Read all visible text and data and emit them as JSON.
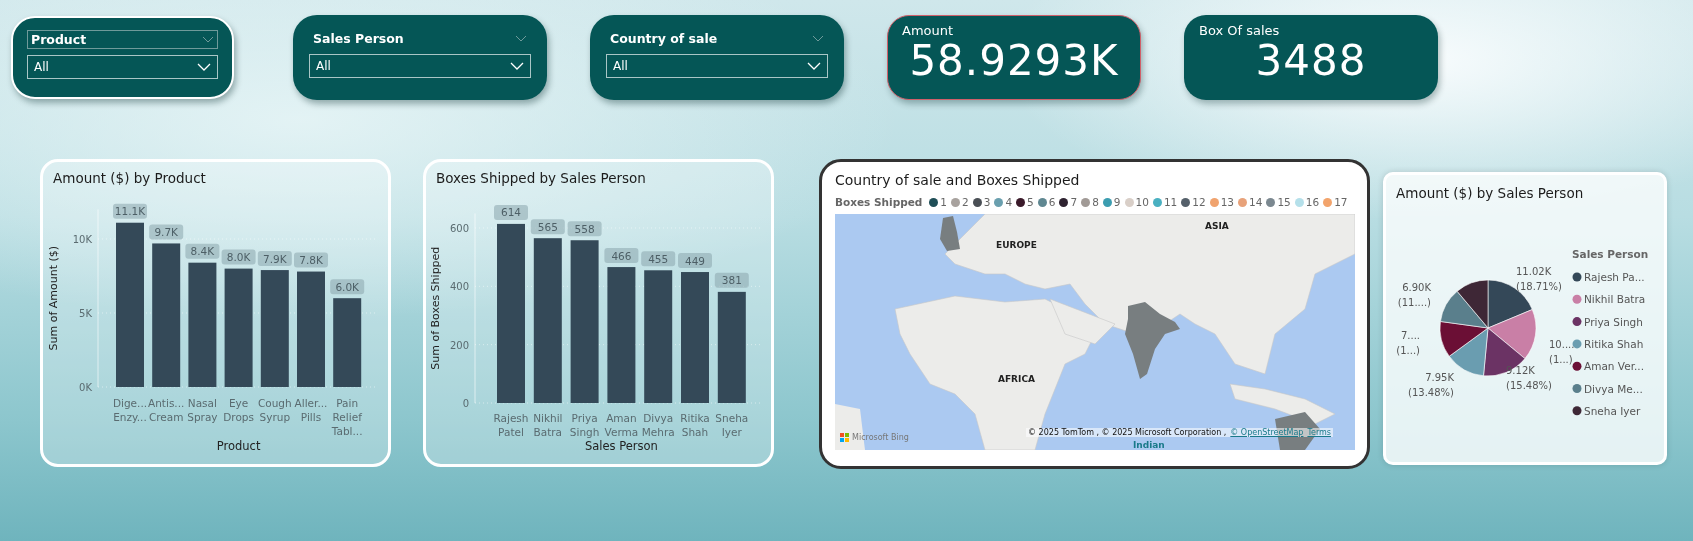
{
  "slicers": [
    {
      "title": "Product",
      "value": "All",
      "selected": true
    },
    {
      "title": "Sales Person",
      "value": "All",
      "selected": false
    },
    {
      "title": "Country of sale",
      "value": "All",
      "selected": false
    }
  ],
  "kpis": [
    {
      "label": "Amount",
      "value": "58.9293K"
    },
    {
      "label": "Box Of sales",
      "value": "3488"
    }
  ],
  "bar_charts": [
    {
      "chart_data": {
        "type": "bar",
        "title": "Amount ($) by Product",
        "xlabel": "Product",
        "ylabel": "Sum of Amount ($)",
        "categories": [
          "Dige... Enzy...",
          "Antis... Cream",
          "Nasal Spray",
          "Eye Drops",
          "Cough Syrup",
          "Aller... Pills",
          "Pain Relief Tabl..."
        ],
        "values": [
          11100,
          9700,
          8400,
          8000,
          7900,
          7800,
          6000
        ],
        "value_labels": [
          "11.1K",
          "9.7K",
          "8.4K",
          "8.0K",
          "7.9K",
          "7.8K",
          "6.0K"
        ],
        "grid": true,
        "ylim": [
          0,
          12000
        ],
        "yticks": [
          {
            "value": 0,
            "label": "0K"
          },
          {
            "value": 5000,
            "label": "5K"
          },
          {
            "value": 10000,
            "label": "10K"
          }
        ]
      }
    },
    {
      "chart_data": {
        "type": "bar",
        "title": "Boxes Shipped by Sales Person",
        "xlabel": "Sales Person",
        "ylabel": "Sum of Boxes Shipped",
        "categories": [
          "Rajesh Patel",
          "Nikhil Batra",
          "Priya Singh",
          "Aman Verma",
          "Divya Mehra",
          "Ritika Shah",
          "Sneha Iyer"
        ],
        "values": [
          614,
          565,
          558,
          466,
          455,
          449,
          381
        ],
        "value_labels": [
          "614",
          "565",
          "558",
          "466",
          "455",
          "449",
          "381"
        ],
        "grid": true,
        "ylim": [
          0,
          650
        ],
        "yticks": [
          0,
          200,
          400,
          600
        ]
      }
    }
  ],
  "map": {
    "title": "Country of sale and Boxes Shipped",
    "legend": {
      "title": "Boxes Shipped",
      "items": [
        {
          "label": "1",
          "color": "#1f4e57"
        },
        {
          "label": "2",
          "color": "#a8a29e"
        },
        {
          "label": "3",
          "color": "#4a4f55"
        },
        {
          "label": "4",
          "color": "#6a9fae"
        },
        {
          "label": "5",
          "color": "#3b1a2a"
        },
        {
          "label": "6",
          "color": "#5f8791"
        },
        {
          "label": "7",
          "color": "#2e2230"
        },
        {
          "label": "8",
          "color": "#a19a96"
        },
        {
          "label": "9",
          "color": "#3c9db0"
        },
        {
          "label": "10",
          "color": "#d9cfc8"
        },
        {
          "label": "11",
          "color": "#4ab0c1"
        },
        {
          "label": "12",
          "color": "#55606a"
        },
        {
          "label": "13",
          "color": "#f0a36e"
        },
        {
          "label": "14",
          "color": "#e8a27a"
        },
        {
          "label": "15",
          "color": "#7b8890"
        },
        {
          "label": "16",
          "color": "#b5e0ea"
        },
        {
          "label": "17",
          "color": "#f2a46c"
        }
      ]
    },
    "region_labels": [
      "EUROPE",
      "ASIA",
      "AFRICA",
      "Indian"
    ],
    "logo": "Microsoft Bing",
    "attribution": "© 2025 TomTom , © 2025 Microsoft Corporation ,",
    "attribution_links": [
      "© OpenStreetMap",
      "Terms"
    ]
  },
  "pie_chart": {
    "legend_title": "Sales Person",
    "slice_labels": [
      "11.02K (18.71%)",
      "6.90K (11....)",
      "7.... (1...)",
      "10.... (1...)",
      "9.12K (15.48%)",
      "7.95K (13.48%)"
    ],
    "chart_data": {
      "type": "pie",
      "title": "Amount ($) by Sales Person",
      "categories": [
        "Rajesh Pa...",
        "Nikhil Batra",
        "Priya Singh",
        "Ritika Shah",
        "Aman Ver...",
        "Divya Me...",
        "Sneha Iyer"
      ],
      "values": [
        18.71,
        17.3,
        15.48,
        13.48,
        12.2,
        11.71,
        11.12
      ],
      "colors": [
        "#344858",
        "#c97fa6",
        "#6b3364",
        "#6a9db0",
        "#6b0f35",
        "#5a7f8c",
        "#3e2736"
      ],
      "legend": "right"
    }
  }
}
